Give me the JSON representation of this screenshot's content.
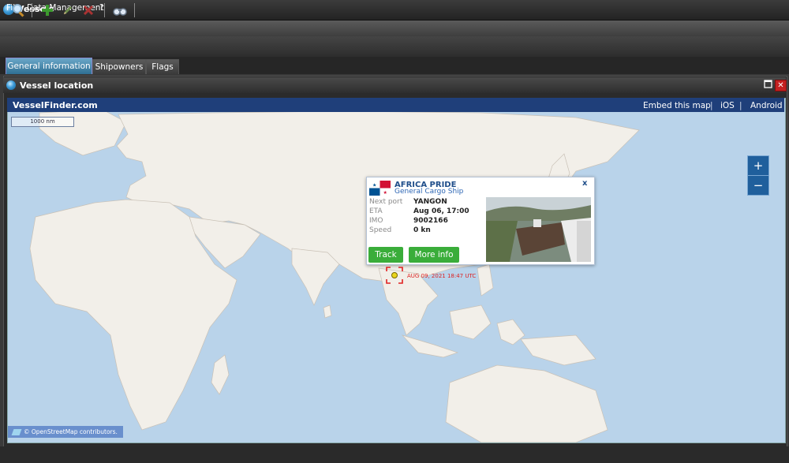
{
  "window": {
    "title": "Vessels"
  },
  "menu": {
    "items": [
      "File",
      "Data Management",
      "?"
    ]
  },
  "tabs": [
    {
      "label": "General information",
      "active": true
    },
    {
      "label": "Shipowners",
      "active": false
    },
    {
      "label": "Flags",
      "active": false
    }
  ],
  "panel": {
    "title": "Vessel location"
  },
  "map": {
    "brand": "VesselFinder.com",
    "links": [
      "Embed this map",
      "iOS",
      "Android"
    ],
    "scale": "1000 nm",
    "zoom_in": "+",
    "zoom_out": "−",
    "attribution": "© OpenStreetMap contributors."
  },
  "popup": {
    "vessel_name": "AFRICA PRIDE",
    "vessel_type": "General Cargo Ship",
    "close": "x",
    "fields": [
      {
        "label": "Next port",
        "value": "YANGON"
      },
      {
        "label": "ETA",
        "value": "Aug 06, 17:00"
      },
      {
        "label": "IMO",
        "value": "9002166"
      },
      {
        "label": "Speed",
        "value": "0 kn"
      }
    ],
    "track_button": "Track",
    "more_info_button": "More info"
  },
  "marker": {
    "timestamp": "AUG 09, 2021 18:47 UTC"
  },
  "colors": {
    "map_water": "#b9d3ea",
    "map_land": "#f2efe9",
    "header": "#1f3f7a",
    "button_green": "#3aad3a"
  }
}
